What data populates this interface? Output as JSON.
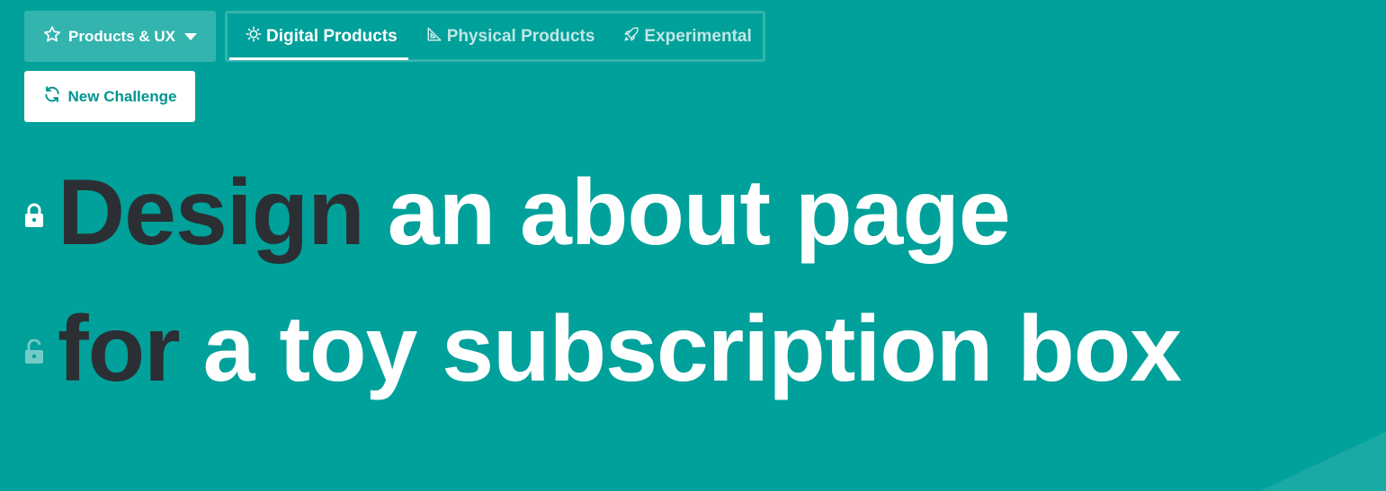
{
  "category_dropdown": {
    "label": "Products & UX",
    "icon": "star-outline-icon"
  },
  "tabs": [
    {
      "label": "Digital Products",
      "icon": "gear-icon",
      "active": true
    },
    {
      "label": "Physical Products",
      "icon": "set-square-icon",
      "active": false
    },
    {
      "label": "Experimental",
      "icon": "rocket-icon",
      "active": false
    }
  ],
  "new_challenge": {
    "label": "New Challenge",
    "icon": "refresh-icon"
  },
  "headline": {
    "line1": {
      "keyword": "Design",
      "rest": "an about page",
      "lock_state": "locked"
    },
    "line2": {
      "keyword": "for",
      "rest": "a toy subscription box",
      "lock_state": "unlocked"
    }
  },
  "colors": {
    "background": "#00a19a",
    "keyword_text": "#2b2f33",
    "button_text": "#00958f",
    "dropdown_bg": "#33b4ae"
  }
}
